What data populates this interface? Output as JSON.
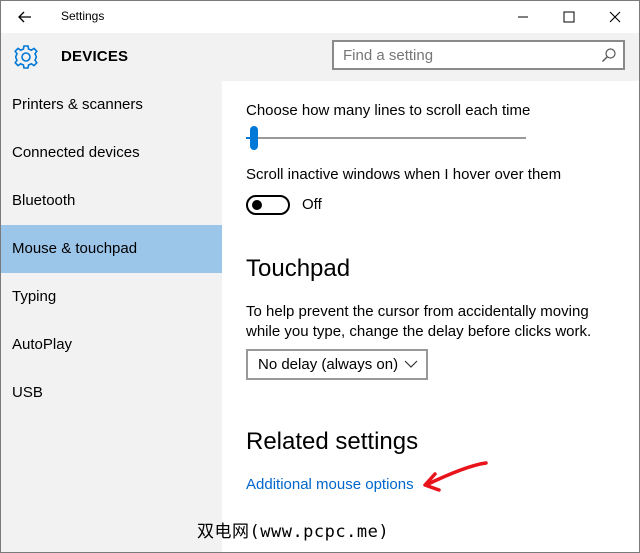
{
  "window": {
    "title": "Settings"
  },
  "header": {
    "title": "DEVICES",
    "search_placeholder": "Find a setting"
  },
  "sidebar": {
    "items": [
      {
        "label": "Printers & scanners",
        "selected": false
      },
      {
        "label": "Connected devices",
        "selected": false
      },
      {
        "label": "Bluetooth",
        "selected": false
      },
      {
        "label": "Mouse & touchpad",
        "selected": true
      },
      {
        "label": "Typing",
        "selected": false
      },
      {
        "label": "AutoPlay",
        "selected": false
      },
      {
        "label": "USB",
        "selected": false
      }
    ]
  },
  "main": {
    "scroll_lines_label": "Choose how many lines to scroll each time",
    "scroll_lines_fraction": 0.03,
    "inactive_scroll_label": "Scroll inactive windows when I hover over them",
    "inactive_scroll_state": "Off",
    "touchpad_heading": "Touchpad",
    "touchpad_description": "To help prevent the cursor from accidentally moving while you type, change the delay before clicks work.",
    "delay_selected": "No delay (always on)",
    "related_heading": "Related settings",
    "related_link": "Additional mouse options"
  },
  "watermark": "双电网(www.pcpc.me)",
  "colors": {
    "accent": "#0078d7",
    "selected_nav": "#9cc5ea",
    "link": "#0066cc",
    "annotation_arrow": "#e8131b",
    "pane_background": "#f2f2f2"
  },
  "icons": {
    "back": "back-arrow-icon",
    "header": "gear-icon",
    "search": "search-icon",
    "minimize": "minimize-icon",
    "maximize": "maximize-icon",
    "close": "close-icon",
    "dropdown": "chevron-down-icon",
    "annotation": "red-arrow-icon"
  }
}
